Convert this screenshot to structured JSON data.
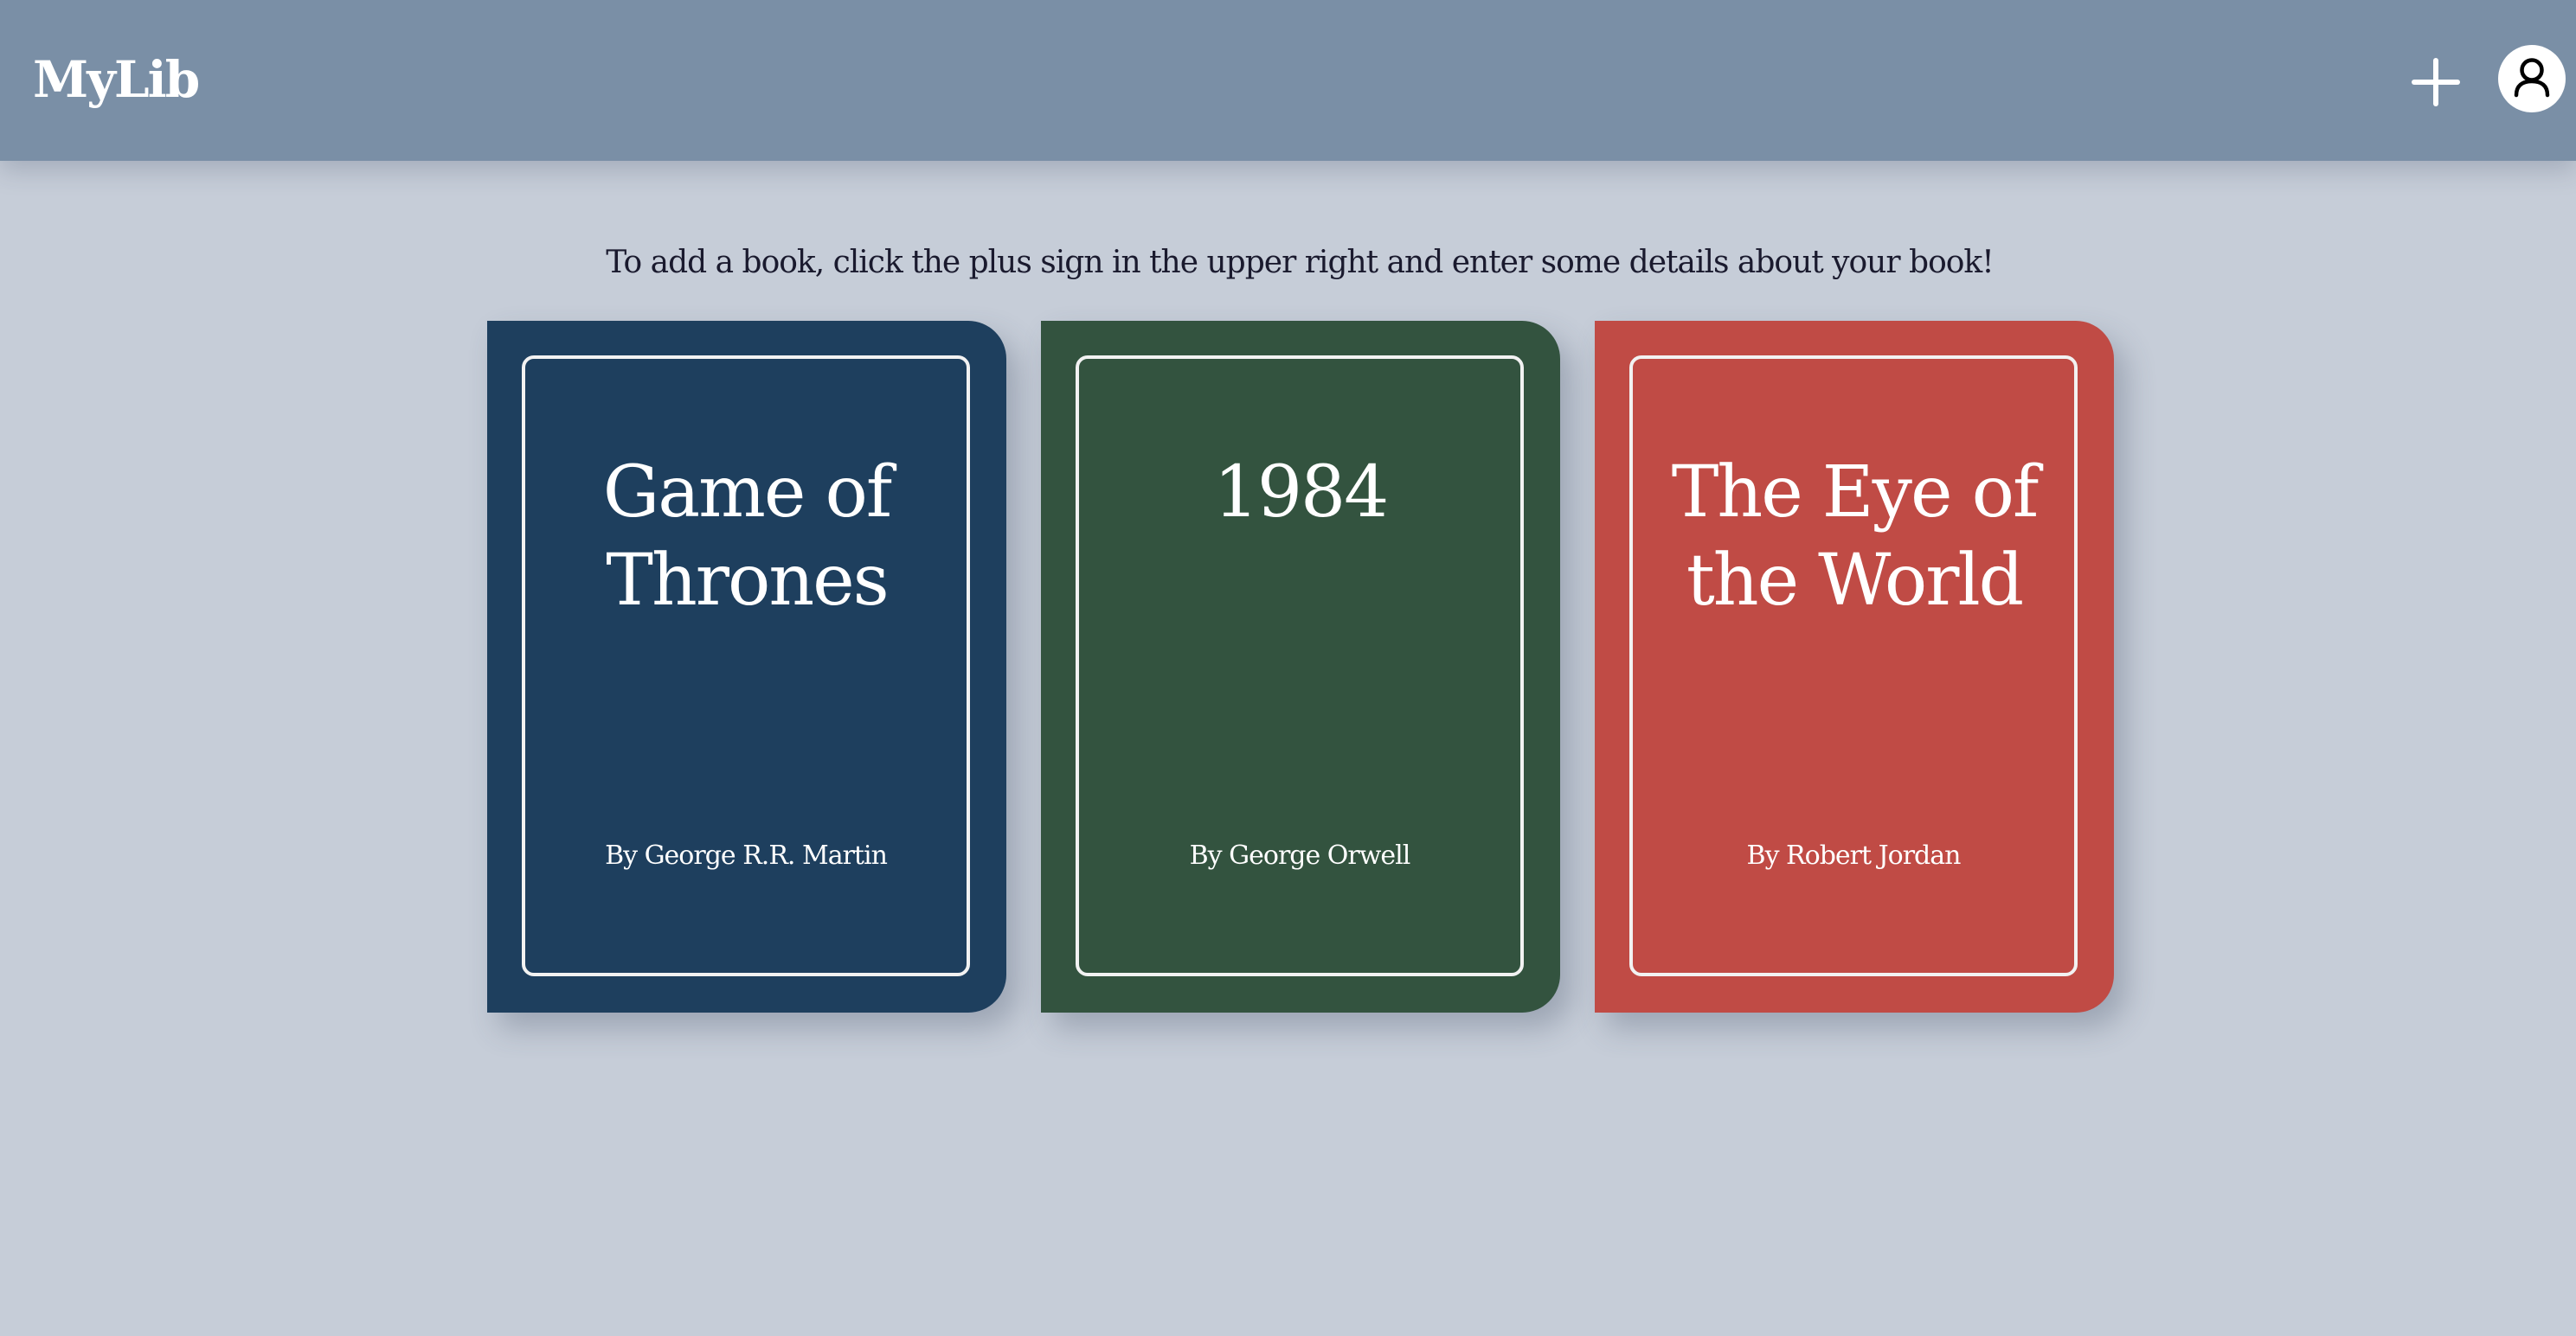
{
  "header": {
    "logo": "MyLib",
    "add_icon": "plus-icon",
    "profile_icon": "user-icon"
  },
  "main": {
    "instructions": "To add a book, click the plus sign in the upper right and enter some details about your book!"
  },
  "books": [
    {
      "title": "Game of Thrones",
      "author_line": "By George R.R. Martin",
      "cover_color": "#1e3f5e"
    },
    {
      "title": "1984",
      "author_line": "By George Orwell",
      "cover_color": "#33533f"
    },
    {
      "title": "The Eye of the World",
      "author_line": "By Robert Jordan",
      "cover_color": "#c04b45"
    }
  ],
  "colors": {
    "header": "#7a8fa6",
    "background": "#c6cdd8",
    "text": "#1a1a2e"
  }
}
